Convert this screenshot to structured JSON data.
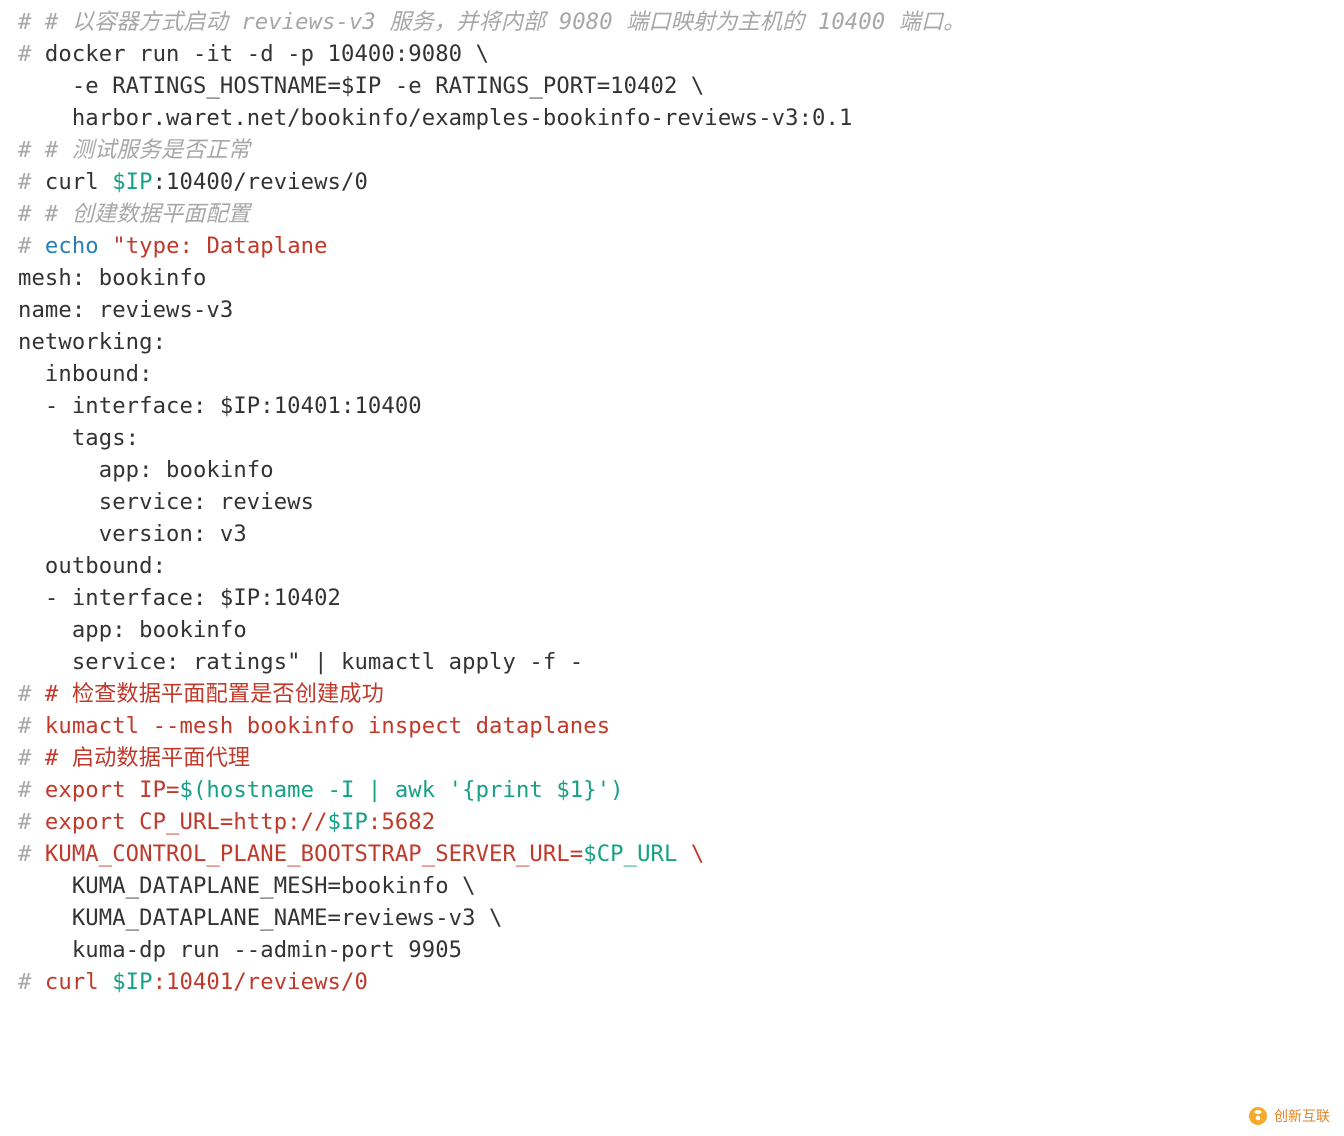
{
  "lines": {
    "l1_a": "# ",
    "l1_b": "# 以容器方式启动 reviews-v3 服务，并将内部 9080 端口映射为主机的 10400 端口。",
    "l2_a": "# ",
    "l2_b": "docker run -it -d -p 10400:9080 \\",
    "l3": "    -e RATINGS_HOSTNAME=$IP -e RATINGS_PORT=10402 \\",
    "l4": "    harbor.waret.net/bookinfo/examples-bookinfo-reviews-v3:0.1",
    "l5_a": "# ",
    "l5_b": "# 测试服务是否正常",
    "l6_a": "# ",
    "l6_b": "curl ",
    "l6_c": "$IP",
    "l6_d": ":10400/reviews/0",
    "l7_a": "# ",
    "l7_b": "# 创建数据平面配置",
    "l8_a": "# ",
    "l8_b": "echo",
    "l8_c": " ",
    "l8_d": "\"type: Dataplane",
    "l9": "mesh: bookinfo",
    "l10": "name: reviews-v3",
    "l11": "networking:",
    "l12": "  inbound:",
    "l13": "  - interface: $IP:10401:10400",
    "l14": "    tags:",
    "l15": "      app: bookinfo",
    "l16": "      service: reviews",
    "l17": "      version: v3",
    "l18": "  outbound:",
    "l19": "  - interface: $IP:10402",
    "l20": "    app: bookinfo",
    "l21_a": "    service: ratings\"",
    "l21_b": " | kumactl apply -f -",
    "l22_a": "# ",
    "l22_b": "# 检查数据平面配置是否创建成功",
    "l23_a": "# ",
    "l23_b": "kumactl --mesh bookinfo inspect dataplanes",
    "l24_a": "# ",
    "l24_b": "# 启动数据平面代理",
    "l25_a": "# ",
    "l25_b": "export IP=",
    "l25_c": "$(hostname -I | awk '{print $1}')",
    "l26_a": "# ",
    "l26_b": "export CP_URL=http://",
    "l26_c": "$IP",
    "l26_d": ":5682",
    "l27_a": "# ",
    "l27_b": "KUMA_CONTROL_PLANE_BOOTSTRAP_SERVER_URL=",
    "l27_c": "$CP_URL",
    "l27_d": " \\",
    "l28": "    KUMA_DATAPLANE_MESH=bookinfo \\",
    "l29": "    KUMA_DATAPLANE_NAME=reviews-v3 \\",
    "l30": "    kuma-dp run --admin-port 9905",
    "l31_a": "# ",
    "l31_b": "curl ",
    "l31_c": "$IP",
    "l31_d": ":10401/reviews/0"
  },
  "watermark": "创新互联"
}
